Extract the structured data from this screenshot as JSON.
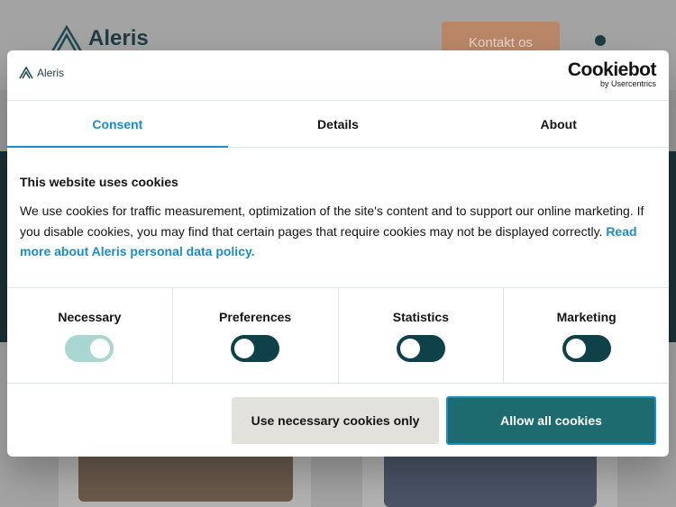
{
  "background": {
    "logo_text": "Aleris",
    "contact_button": "Kontakt os"
  },
  "dialog": {
    "logo_text": "Aleris",
    "cookiebot": {
      "name": "Cookiebot",
      "subtitle": "by Usercentrics"
    },
    "tabs": [
      {
        "label": "Consent",
        "active": true
      },
      {
        "label": "Details",
        "active": false
      },
      {
        "label": "About",
        "active": false
      }
    ],
    "title": "This website uses cookies",
    "text": "We use cookies for traffic measurement, optimization of the site's content and to support our online marketing. If you disable cookies, you may find that certain pages that require cookies may not be displayed correctly.",
    "policy_link": "Read more about Aleris personal data policy.",
    "categories": [
      {
        "label": "Necessary",
        "enabled": true,
        "locked": true
      },
      {
        "label": "Preferences",
        "enabled": false
      },
      {
        "label": "Statistics",
        "enabled": false
      },
      {
        "label": "Marketing",
        "enabled": false
      }
    ],
    "buttons": {
      "necessary_only": "Use necessary cookies only",
      "allow_all": "Allow all cookies"
    }
  },
  "colors": {
    "accent_blue": "#1a8cc7",
    "toggle_off": "#0e4148",
    "toggle_on_locked": "#a9d6d0",
    "allow_button": "#1e6b6f"
  }
}
